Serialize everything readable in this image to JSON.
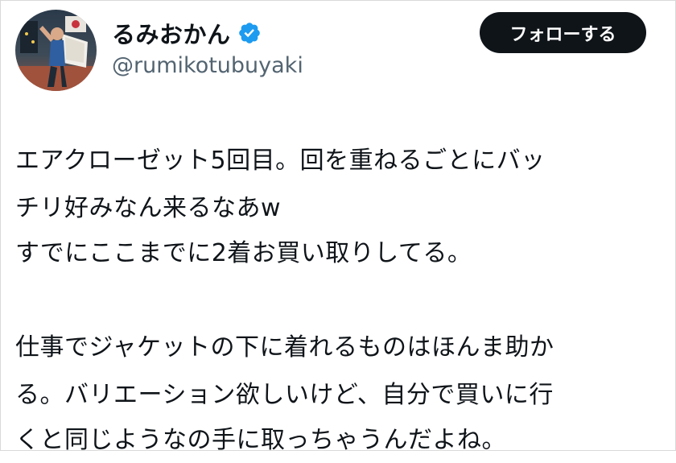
{
  "author": {
    "display_name": "るみおかん",
    "handle": "@rumikotubuyaki",
    "verified_icon": "verified-badge-icon",
    "verified_color": "#1d9bf0"
  },
  "follow_button": {
    "label": "フォローする"
  },
  "tweet": {
    "paragraph_1": [
      "エアクローゼット5回目。回を重ねるごとにバッ",
      "チリ好みなん来るなあw",
      "すでにここまでに2着お買い取りしてる。"
    ],
    "paragraph_2": [
      "仕事でジャケットの下に着れるものはほんま助か",
      "る。バリエーション欲しいけど、自分で買いに行",
      "くと同じようなの手に取っちゃうんだよね。"
    ]
  },
  "colors": {
    "text": "#0f1419",
    "secondary_text": "#536471",
    "button_bg": "#0f1419",
    "button_text": "#ffffff"
  }
}
